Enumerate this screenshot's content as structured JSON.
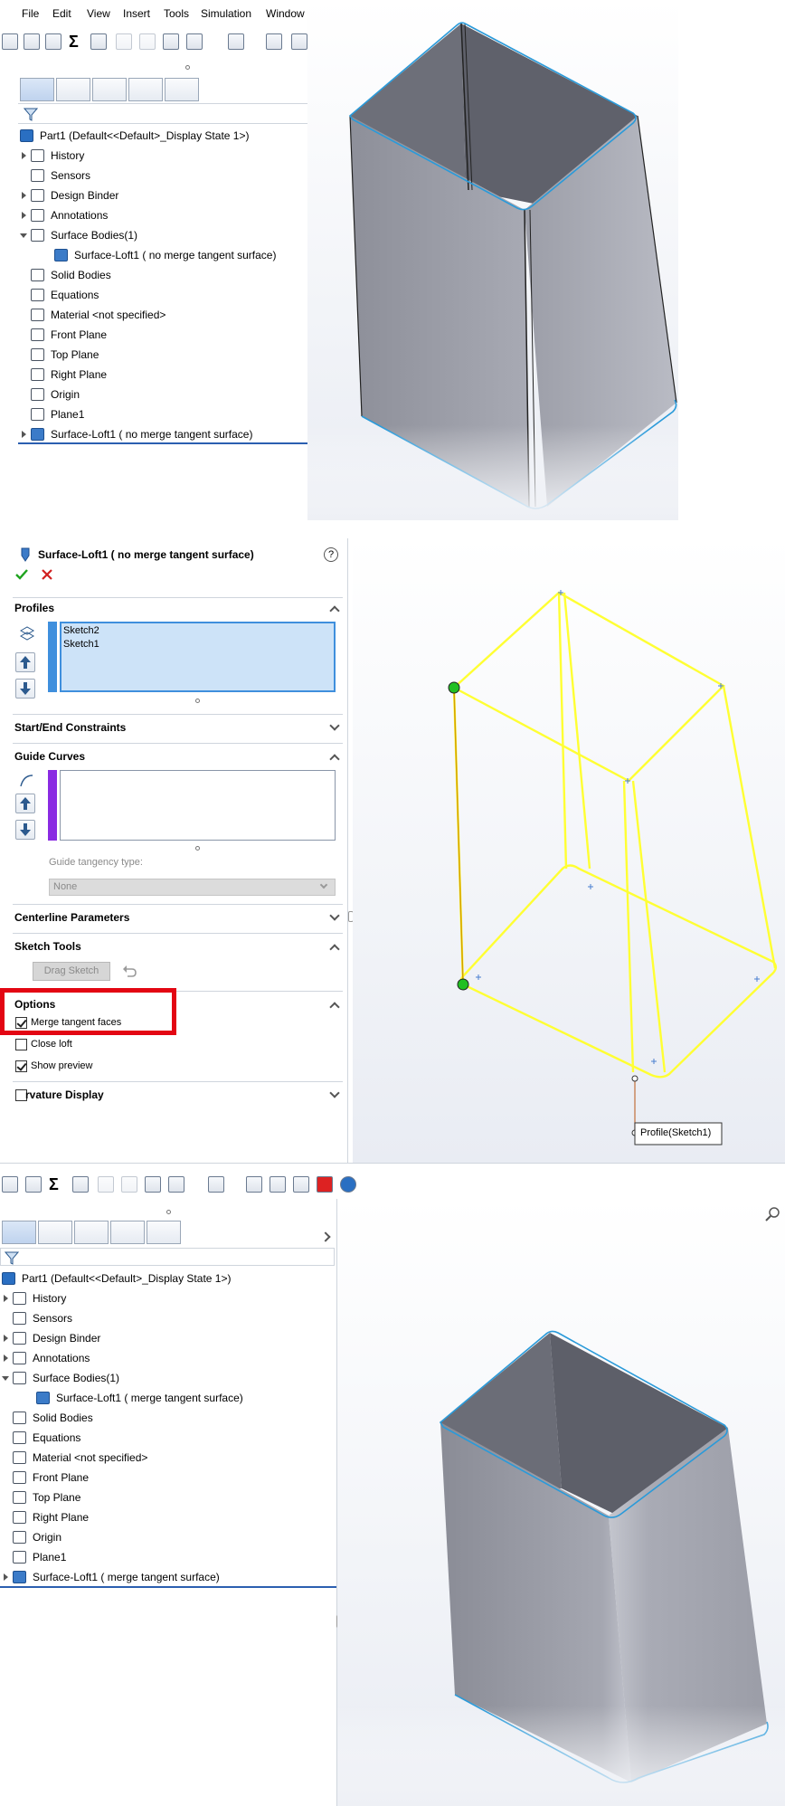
{
  "panel1": {
    "menu": [
      "File",
      "Edit",
      "View",
      "Insert",
      "Tools",
      "Simulation",
      "Window"
    ],
    "tree": {
      "root": "Part1  (Default<<Default>_Display State 1>)",
      "items": [
        {
          "label": "History",
          "icon": "history-folder-icon",
          "expand": "right"
        },
        {
          "label": "Sensors",
          "icon": "sensors-folder-icon",
          "expand": ""
        },
        {
          "label": "Design Binder",
          "icon": "design-binder-icon",
          "expand": "right"
        },
        {
          "label": "Annotations",
          "icon": "annotations-folder-icon",
          "expand": "right"
        },
        {
          "label": "Surface Bodies(1)",
          "icon": "surface-bodies-folder-icon",
          "expand": "down"
        },
        {
          "label": "Surface-Loft1 ( no merge tangent surface)",
          "icon": "surface-body-icon",
          "expand": ""
        },
        {
          "label": "Solid Bodies",
          "icon": "solid-bodies-folder-icon",
          "expand": ""
        },
        {
          "label": "Equations",
          "icon": "equations-folder-icon",
          "expand": ""
        },
        {
          "label": "Material <not specified>",
          "icon": "material-icon",
          "expand": ""
        },
        {
          "label": "Front Plane",
          "icon": "plane-icon",
          "expand": ""
        },
        {
          "label": "Top Plane",
          "icon": "plane-icon",
          "expand": ""
        },
        {
          "label": "Right Plane",
          "icon": "plane-icon",
          "expand": ""
        },
        {
          "label": "Origin",
          "icon": "origin-icon",
          "expand": ""
        },
        {
          "label": "Plane1",
          "icon": "plane-icon",
          "expand": ""
        },
        {
          "label": "Surface-Loft1 ( no merge tangent surface)",
          "icon": "loft-feature-icon",
          "expand": "right"
        }
      ]
    }
  },
  "panel2": {
    "title": "Surface-Loft1 ( no merge tangent surface)",
    "help": "?",
    "sections": {
      "profiles": "Profiles",
      "profile_items": [
        "Sketch2",
        "Sketch1"
      ],
      "start_end": "Start/End Constraints",
      "guide_curves": "Guide Curves",
      "guide_tangency_label": "Guide tangency type:",
      "guide_tangency_value": "None",
      "centerline": "Centerline Parameters",
      "sketch_tools": "Sketch Tools",
      "drag_sketch": "Drag Sketch",
      "options": "Options",
      "merge_tangent": "Merge tangent faces",
      "close_loft": "Close loft",
      "show_preview": "Show preview",
      "curvature": "rvature Display"
    },
    "checks": {
      "merge_tangent": true,
      "close_loft": false,
      "show_preview": true,
      "curvature": false
    },
    "callout": "Profile(Sketch1)",
    "colors": {
      "highlight": "#e30613",
      "preview": "#ffff33"
    }
  },
  "panel3": {
    "tree": {
      "root": "Part1  (Default<<Default>_Display State 1>)",
      "items": [
        {
          "label": "History",
          "icon": "history-folder-icon",
          "expand": "right"
        },
        {
          "label": "Sensors",
          "icon": "sensors-folder-icon",
          "expand": ""
        },
        {
          "label": "Design Binder",
          "icon": "design-binder-icon",
          "expand": "right"
        },
        {
          "label": "Annotations",
          "icon": "annotations-folder-icon",
          "expand": "right"
        },
        {
          "label": "Surface Bodies(1)",
          "icon": "surface-bodies-folder-icon",
          "expand": "down"
        },
        {
          "label": "Surface-Loft1 ( merge tangent surface)",
          "icon": "surface-body-icon",
          "expand": ""
        },
        {
          "label": "Solid Bodies",
          "icon": "solid-bodies-folder-icon",
          "expand": ""
        },
        {
          "label": "Equations",
          "icon": "equations-folder-icon",
          "expand": ""
        },
        {
          "label": "Material <not specified>",
          "icon": "material-icon",
          "expand": ""
        },
        {
          "label": "Front Plane",
          "icon": "plane-icon",
          "expand": ""
        },
        {
          "label": "Top Plane",
          "icon": "plane-icon",
          "expand": ""
        },
        {
          "label": "Right Plane",
          "icon": "plane-icon",
          "expand": ""
        },
        {
          "label": "Origin",
          "icon": "origin-icon",
          "expand": ""
        },
        {
          "label": "Plane1",
          "icon": "plane-icon",
          "expand": ""
        },
        {
          "label": "Surface-Loft1 ( merge tangent surface)",
          "icon": "loft-feature-icon",
          "expand": "right"
        }
      ]
    }
  }
}
